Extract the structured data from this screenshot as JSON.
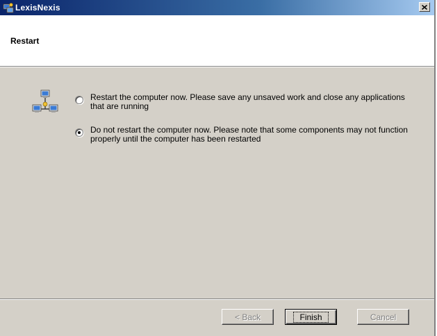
{
  "window": {
    "title": "LexisNexis",
    "close_glyph": "×"
  },
  "header": {
    "title": "Restart"
  },
  "options": [
    {
      "label": "Restart the computer now.  Please save any unsaved work and close any applications that are running",
      "selected": false
    },
    {
      "label": "Do not restart the computer now.  Please note that some components may not function properly until the computer has been restarted",
      "selected": true
    }
  ],
  "buttons": {
    "back_label": "< Back",
    "finish_label": "Finish",
    "cancel_label": "Cancel"
  },
  "icons": {
    "app": "lexisnexis-app-icon",
    "network": "network-computers-icon"
  },
  "colors": {
    "titlebar_start": "#0a246a",
    "titlebar_end": "#a6caf0",
    "dialog_face": "#d4d0c8"
  }
}
